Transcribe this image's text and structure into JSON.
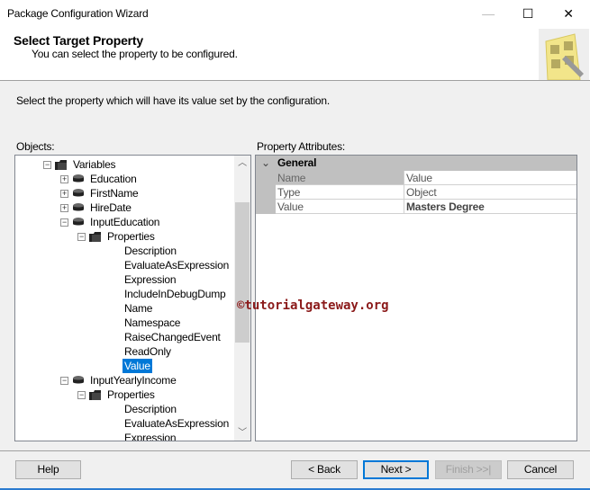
{
  "window": {
    "title": "Package Configuration Wizard",
    "minimize": "—",
    "maximize": "☐",
    "close": "✕"
  },
  "header": {
    "title": "Select Target Property",
    "subtitle": "You can select the property to be configured."
  },
  "instruction": "Select the property which will have its value set by the configuration.",
  "objects_label": "Objects:",
  "properties_label": "Property Attributes:",
  "tree": [
    {
      "label": "Variables",
      "level": 0,
      "expander": "−",
      "icon": "folder"
    },
    {
      "label": "Education",
      "level": 1,
      "expander": "+",
      "icon": "variable"
    },
    {
      "label": "FirstName",
      "level": 1,
      "expander": "+",
      "icon": "variable"
    },
    {
      "label": "HireDate",
      "level": 1,
      "expander": "+",
      "icon": "variable"
    },
    {
      "label": "InputEducation",
      "level": 1,
      "expander": "−",
      "icon": "variable"
    },
    {
      "label": "Properties",
      "level": 2,
      "expander": "−",
      "icon": "folder"
    },
    {
      "label": "Description",
      "level": 3
    },
    {
      "label": "EvaluateAsExpression",
      "level": 3
    },
    {
      "label": "Expression",
      "level": 3
    },
    {
      "label": "IncludeInDebugDump",
      "level": 3
    },
    {
      "label": "Name",
      "level": 3
    },
    {
      "label": "Namespace",
      "level": 3
    },
    {
      "label": "RaiseChangedEvent",
      "level": 3
    },
    {
      "label": "ReadOnly",
      "level": 3
    },
    {
      "label": "Value",
      "level": 3,
      "selected": true
    },
    {
      "label": "InputYearlyIncome",
      "level": 1,
      "expander": "−",
      "icon": "variable"
    },
    {
      "label": "Properties",
      "level": 2,
      "expander": "−",
      "icon": "folder"
    },
    {
      "label": "Description",
      "level": 3
    },
    {
      "label": "EvaluateAsExpression",
      "level": 3
    },
    {
      "label": "Expression",
      "level": 3
    }
  ],
  "grid": {
    "category": "General",
    "rows": [
      {
        "name": "Name",
        "value": "Value"
      },
      {
        "name": "Type",
        "value": "Object"
      },
      {
        "name": "Value",
        "value": "Masters Degree",
        "bold": true
      }
    ]
  },
  "watermark": "©tutorialgateway.org",
  "buttons": {
    "help": "Help",
    "back": "< Back",
    "next": "Next >",
    "finish": "Finish >>|",
    "cancel": "Cancel"
  }
}
